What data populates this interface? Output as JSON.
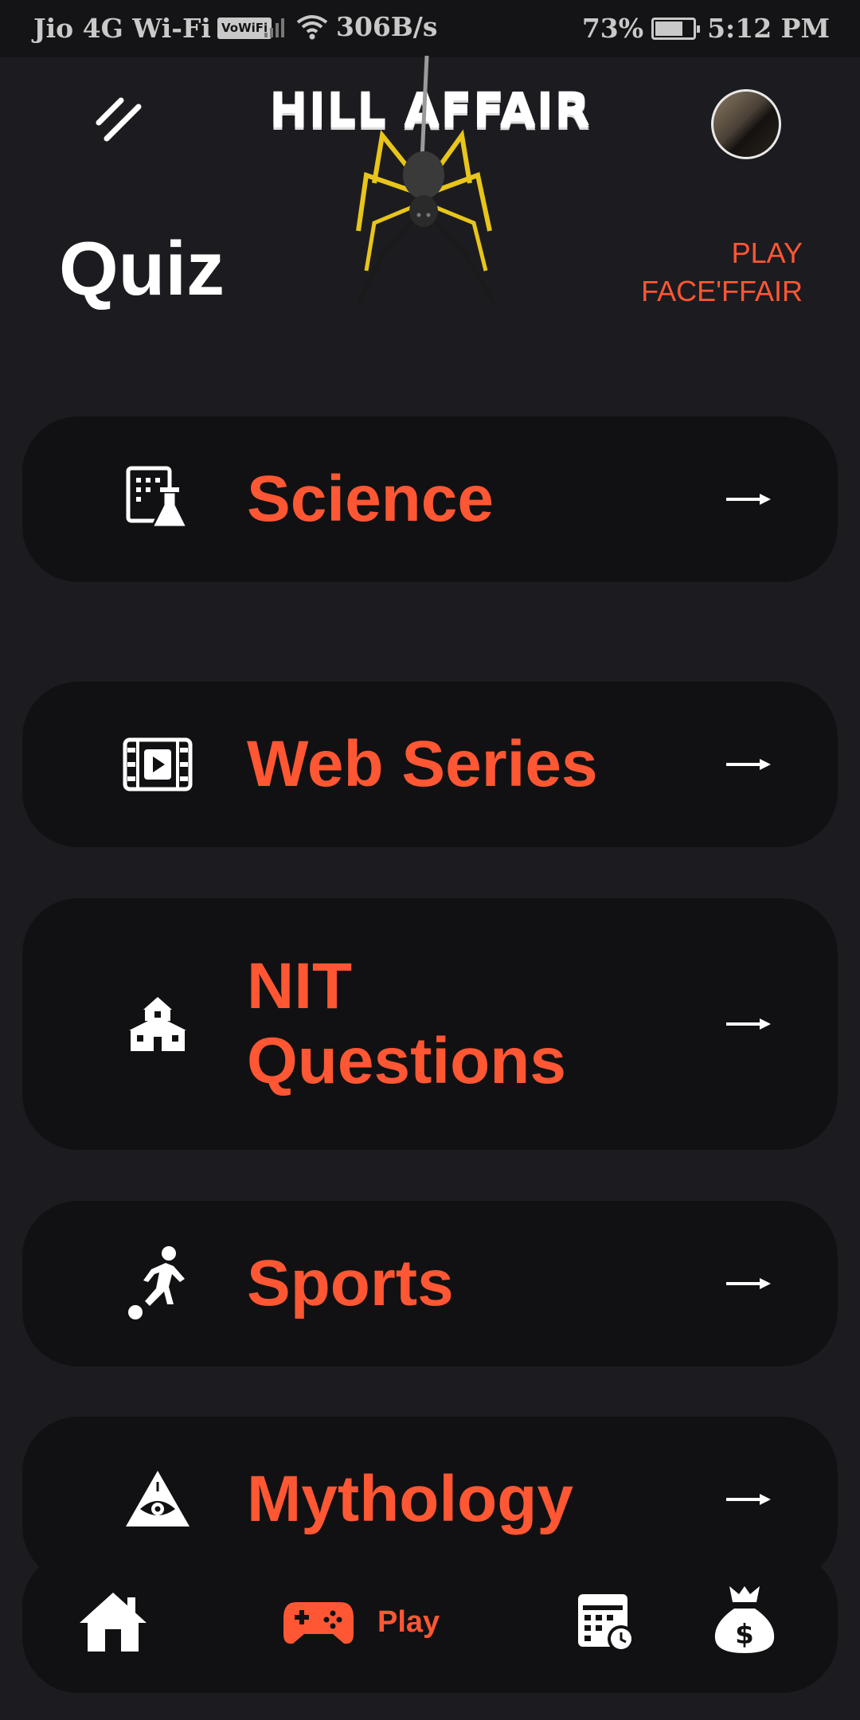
{
  "status_bar": {
    "carrier": "Jio 4G Wi-Fi",
    "vowifi": "VoWiFi",
    "speed": "306B/s",
    "battery": "73%",
    "battery_level": 0.73,
    "time": "5:12 PM"
  },
  "header": {
    "brand": "HILL AFFAIR",
    "menu_icon": "menu-slash-icon",
    "avatar_icon": "avatar"
  },
  "page": {
    "title": "Quiz",
    "link_line1": "PLAY",
    "link_line2": "FACE'FFAIR"
  },
  "categories": [
    {
      "label": "Science",
      "icon": "science-icon"
    },
    {
      "label": "Web Series",
      "icon": "film-icon"
    },
    {
      "label_line1": "NIT",
      "label_line2": "Questions",
      "icon": "school-icon"
    },
    {
      "label": "Sports",
      "icon": "football-player-icon"
    },
    {
      "label": "Mythology",
      "icon": "eye-triangle-icon"
    }
  ],
  "bottom_nav": {
    "home_icon": "home-icon",
    "play_label": "Play",
    "play_icon": "gamepad-icon",
    "calendar_icon": "calendar-clock-icon",
    "money_icon": "money-bag-icon"
  },
  "colors": {
    "accent": "#ff5733",
    "background": "#1c1c20",
    "card": "#111113"
  }
}
